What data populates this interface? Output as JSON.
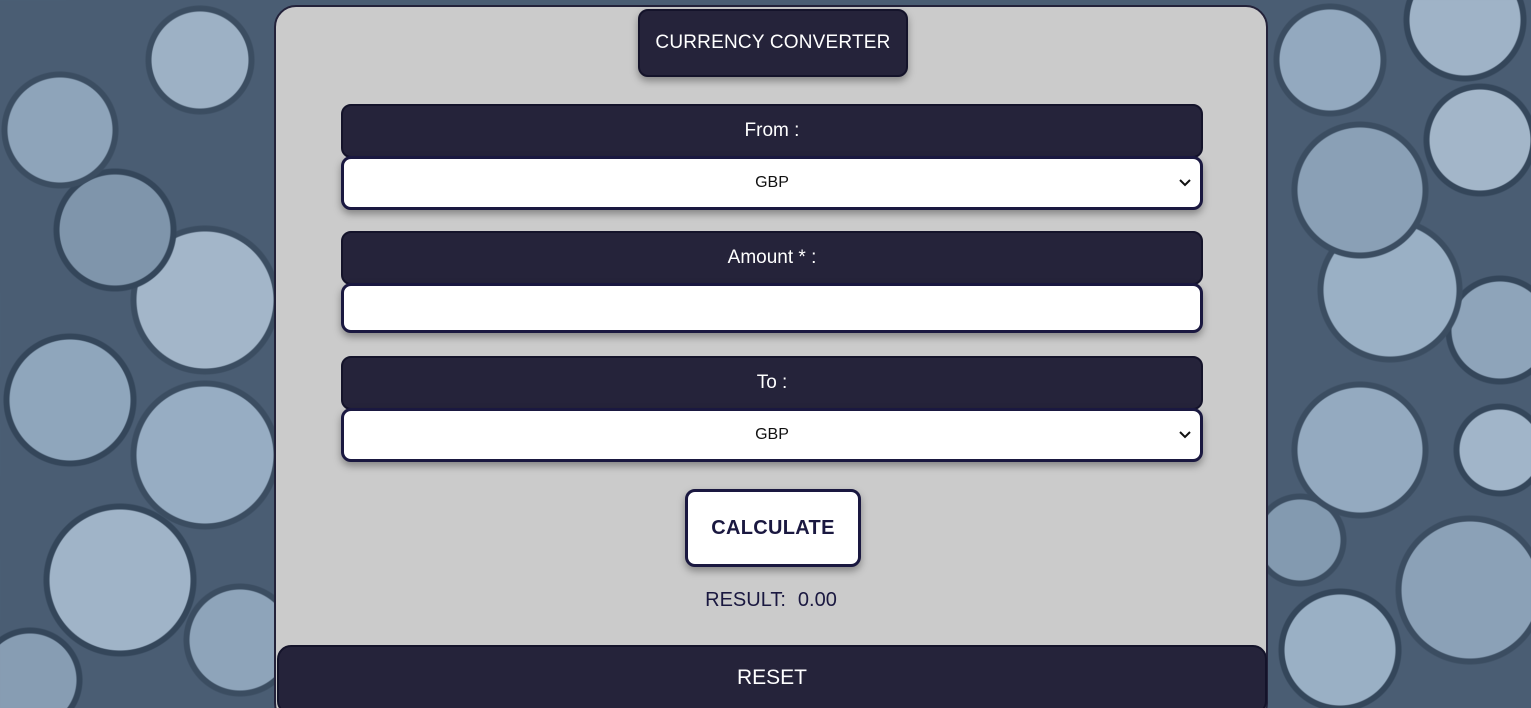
{
  "app": {
    "title": "CURRENCY CONVERTER"
  },
  "form": {
    "from": {
      "label": "From :",
      "selected": "GBP"
    },
    "amount": {
      "label": "Amount * :",
      "value": "",
      "placeholder": ""
    },
    "to": {
      "label": "To :",
      "selected": "GBP"
    }
  },
  "actions": {
    "calculate_label": "CALCULATE",
    "reset_label": "RESET"
  },
  "result": {
    "label": "RESULT:",
    "value": "0.00"
  },
  "colors": {
    "panel": "#cbcbcb",
    "dark": "#25233a",
    "accent": "#1a1840"
  },
  "icons": {
    "select_arrow": "chevron-down-icon"
  }
}
